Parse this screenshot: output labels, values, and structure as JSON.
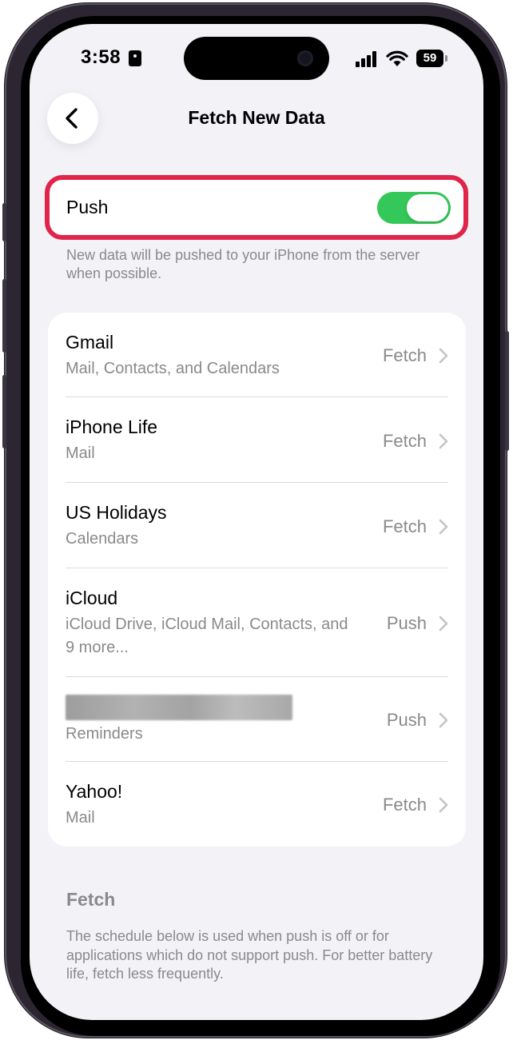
{
  "status_bar": {
    "time": "3:58",
    "battery": "59"
  },
  "nav": {
    "title": "Fetch New Data"
  },
  "push": {
    "label": "Push",
    "enabled": true,
    "footer": "New data will be pushed to your iPhone from the server when possible."
  },
  "accounts": [
    {
      "title": "Gmail",
      "subtitle": "Mail, Contacts, and Calendars",
      "value": "Fetch"
    },
    {
      "title": "iPhone Life",
      "subtitle": "Mail",
      "value": "Fetch"
    },
    {
      "title": "US Holidays",
      "subtitle": "Calendars",
      "value": "Fetch"
    },
    {
      "title": "iCloud",
      "subtitle": "iCloud Drive, iCloud Mail, Contacts, and 9 more...",
      "value": "Push"
    },
    {
      "title": "",
      "subtitle": "Reminders",
      "value": "Push"
    },
    {
      "title": "Yahoo!",
      "subtitle": "Mail",
      "value": "Fetch"
    }
  ],
  "fetch_section": {
    "header": "Fetch",
    "footer": "The schedule below is used when push is off or for applications which do not support push. For better battery life, fetch less frequently."
  },
  "colors": {
    "toggle_on": "#34c759",
    "highlight": "#e0244a",
    "background": "#f2f2f7",
    "secondary_text": "#8a8a8e"
  }
}
